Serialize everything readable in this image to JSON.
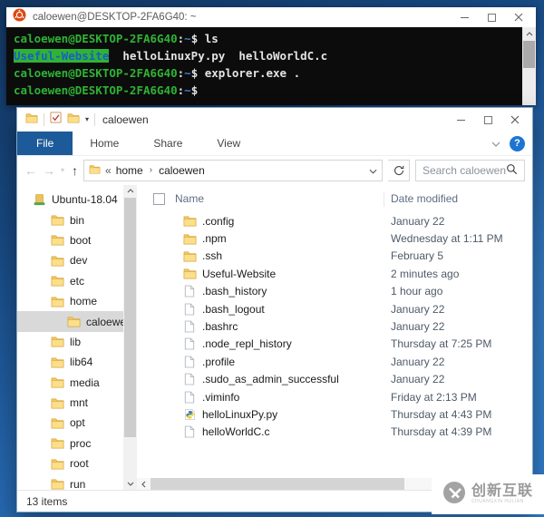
{
  "terminal": {
    "title": "caloewen@DESKTOP-2FA6G40: ~",
    "lines": [
      [
        {
          "t": "caloewen@DESKTOP-2FA6G40",
          "c": "green"
        },
        {
          "t": ":",
          "c": "white"
        },
        {
          "t": "~",
          "c": "blue"
        },
        {
          "t": "$ ls",
          "c": "white"
        }
      ],
      [
        {
          "t": "Useful-Website",
          "c": "dir"
        },
        {
          "t": "  helloLinuxPy.py  helloWorldC.c",
          "c": "white"
        }
      ],
      [
        {
          "t": "caloewen@DESKTOP-2FA6G40",
          "c": "green"
        },
        {
          "t": ":",
          "c": "white"
        },
        {
          "t": "~",
          "c": "blue"
        },
        {
          "t": "$ explorer.exe .",
          "c": "white"
        }
      ],
      [
        {
          "t": "caloewen@DESKTOP-2FA6G40",
          "c": "green"
        },
        {
          "t": ":",
          "c": "white"
        },
        {
          "t": "~",
          "c": "blue"
        },
        {
          "t": "$",
          "c": "white"
        }
      ]
    ],
    "colors": {
      "background": "#0c0c0c",
      "green": "#2fb335",
      "blue": "#467dd3",
      "white": "#e4e4e4",
      "dir_bg": "#2fb335",
      "dir_text": "#1b5fc0"
    }
  },
  "explorer": {
    "title": "caloewen",
    "tabs": [
      "File",
      "Home",
      "Share",
      "View"
    ],
    "help_glyph": "?",
    "address": {
      "overflow_glyph": "«",
      "separator": "›",
      "crumbs": [
        "home",
        "caloewen"
      ],
      "search_placeholder": "Search caloewen"
    },
    "sidebar": {
      "items": [
        {
          "label": "Ubuntu-18.04",
          "icon": "ubuntu",
          "level": 0,
          "selected": false
        },
        {
          "label": "bin",
          "icon": "folder",
          "level": 1,
          "selected": false
        },
        {
          "label": "boot",
          "icon": "folder",
          "level": 1,
          "selected": false
        },
        {
          "label": "dev",
          "icon": "folder",
          "level": 1,
          "selected": false
        },
        {
          "label": "etc",
          "icon": "folder",
          "level": 1,
          "selected": false
        },
        {
          "label": "home",
          "icon": "folder",
          "level": 1,
          "selected": false
        },
        {
          "label": "caloewen",
          "icon": "folder",
          "level": 2,
          "selected": true
        },
        {
          "label": "lib",
          "icon": "folder",
          "level": 1,
          "selected": false
        },
        {
          "label": "lib64",
          "icon": "folder",
          "level": 1,
          "selected": false
        },
        {
          "label": "media",
          "icon": "folder",
          "level": 1,
          "selected": false
        },
        {
          "label": "mnt",
          "icon": "folder",
          "level": 1,
          "selected": false
        },
        {
          "label": "opt",
          "icon": "folder",
          "level": 1,
          "selected": false
        },
        {
          "label": "proc",
          "icon": "folder",
          "level": 1,
          "selected": false
        },
        {
          "label": "root",
          "icon": "folder",
          "level": 1,
          "selected": false
        },
        {
          "label": "run",
          "icon": "folder",
          "level": 1,
          "selected": false
        }
      ]
    },
    "files": {
      "columns": {
        "name": "Name",
        "date": "Date modified"
      },
      "rows": [
        {
          "name": ".config",
          "icon": "folder",
          "date": "January 22"
        },
        {
          "name": ".npm",
          "icon": "folder",
          "date": "Wednesday at 1:11 PM"
        },
        {
          "name": ".ssh",
          "icon": "folder",
          "date": "February 5"
        },
        {
          "name": "Useful-Website",
          "icon": "folder",
          "date": "2 minutes ago"
        },
        {
          "name": ".bash_history",
          "icon": "file",
          "date": "1 hour ago"
        },
        {
          "name": ".bash_logout",
          "icon": "file",
          "date": "January 22"
        },
        {
          "name": ".bashrc",
          "icon": "file",
          "date": "January 22"
        },
        {
          "name": ".node_repl_history",
          "icon": "file",
          "date": "Thursday at 7:25 PM"
        },
        {
          "name": ".profile",
          "icon": "file",
          "date": "January 22"
        },
        {
          "name": ".sudo_as_admin_successful",
          "icon": "file",
          "date": "January 22"
        },
        {
          "name": ".viminfo",
          "icon": "file",
          "date": "Friday at 2:13 PM"
        },
        {
          "name": "helloLinuxPy.py",
          "icon": "python",
          "date": "Thursday at 4:43 PM"
        },
        {
          "name": "helloWorldC.c",
          "icon": "file",
          "date": "Thursday at 4:39 PM"
        }
      ]
    },
    "status": "13 items",
    "accent_color": "#1c5a99"
  },
  "watermark": {
    "text": "创新互联",
    "subtext": "CHUANGXIN HULIAN"
  }
}
